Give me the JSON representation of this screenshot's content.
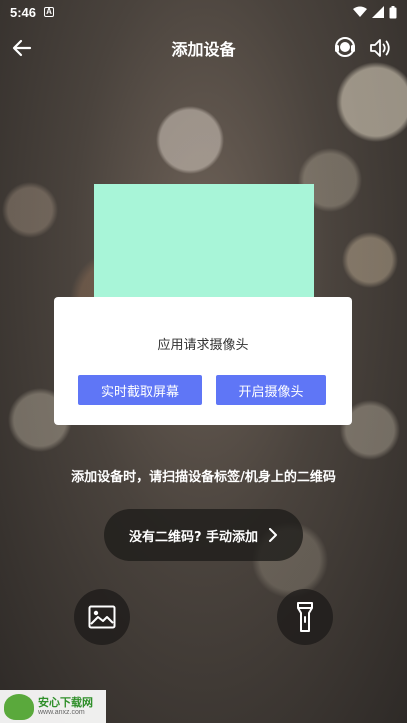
{
  "status_bar": {
    "time": "5:46",
    "icons": [
      "notification-a-icon",
      "wifi-icon",
      "signal-icon",
      "battery-icon"
    ]
  },
  "header": {
    "title": "添加设备",
    "back_icon": "arrow-left-icon",
    "support_icon": "headset-icon",
    "sound_icon": "speaker-icon"
  },
  "dialog": {
    "message": "应用请求摄像头",
    "capture_button": "实时截取屏幕",
    "camera_button": "开启摄像头"
  },
  "scan": {
    "hint": "添加设备时，请扫描设备标签/机身上的二维码",
    "manual_button": "没有二维码? 手动添加"
  },
  "bottom": {
    "gallery_icon": "image-icon",
    "flash_icon": "flashlight-icon"
  },
  "watermark": {
    "title": "安心下载网",
    "url": "www.anxz.com",
    "logo_text": "安心"
  },
  "colors": {
    "accent": "#5f76f6",
    "preview": "#a8f5d8"
  }
}
